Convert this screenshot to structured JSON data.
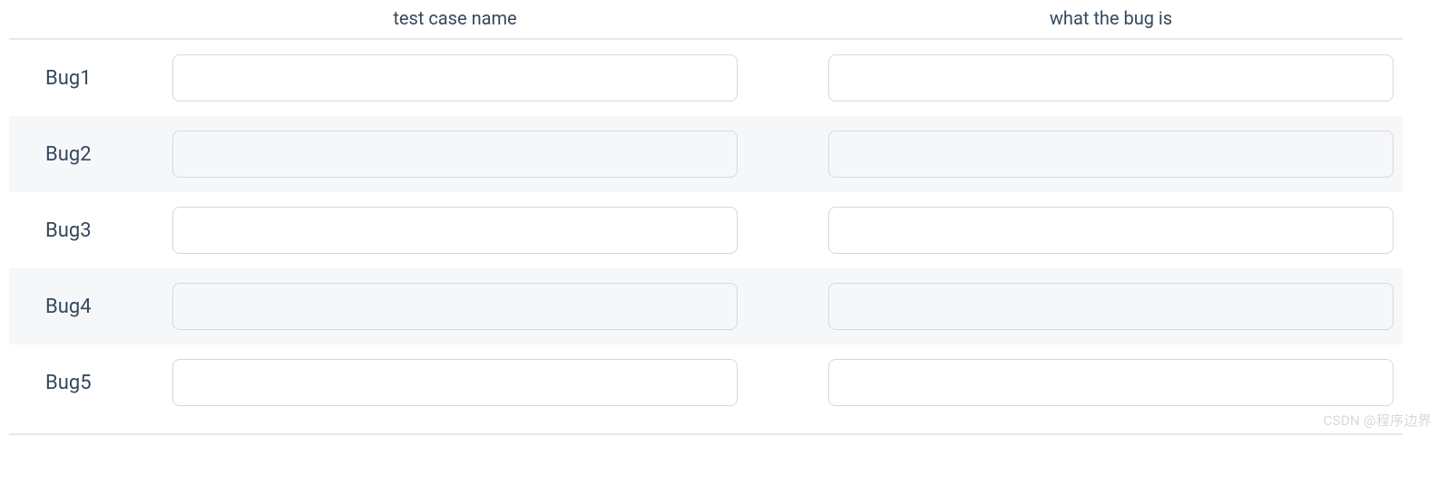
{
  "headers": {
    "col1": "test case name",
    "col2": "what the bug is"
  },
  "rows": [
    {
      "label": "Bug1",
      "testCaseName": "",
      "whatTheBugIs": ""
    },
    {
      "label": "Bug2",
      "testCaseName": "",
      "whatTheBugIs": ""
    },
    {
      "label": "Bug3",
      "testCaseName": "",
      "whatTheBugIs": ""
    },
    {
      "label": "Bug4",
      "testCaseName": "",
      "whatTheBugIs": ""
    },
    {
      "label": "Bug5",
      "testCaseName": "",
      "whatTheBugIs": ""
    }
  ],
  "watermark": "CSDN @程序边界"
}
